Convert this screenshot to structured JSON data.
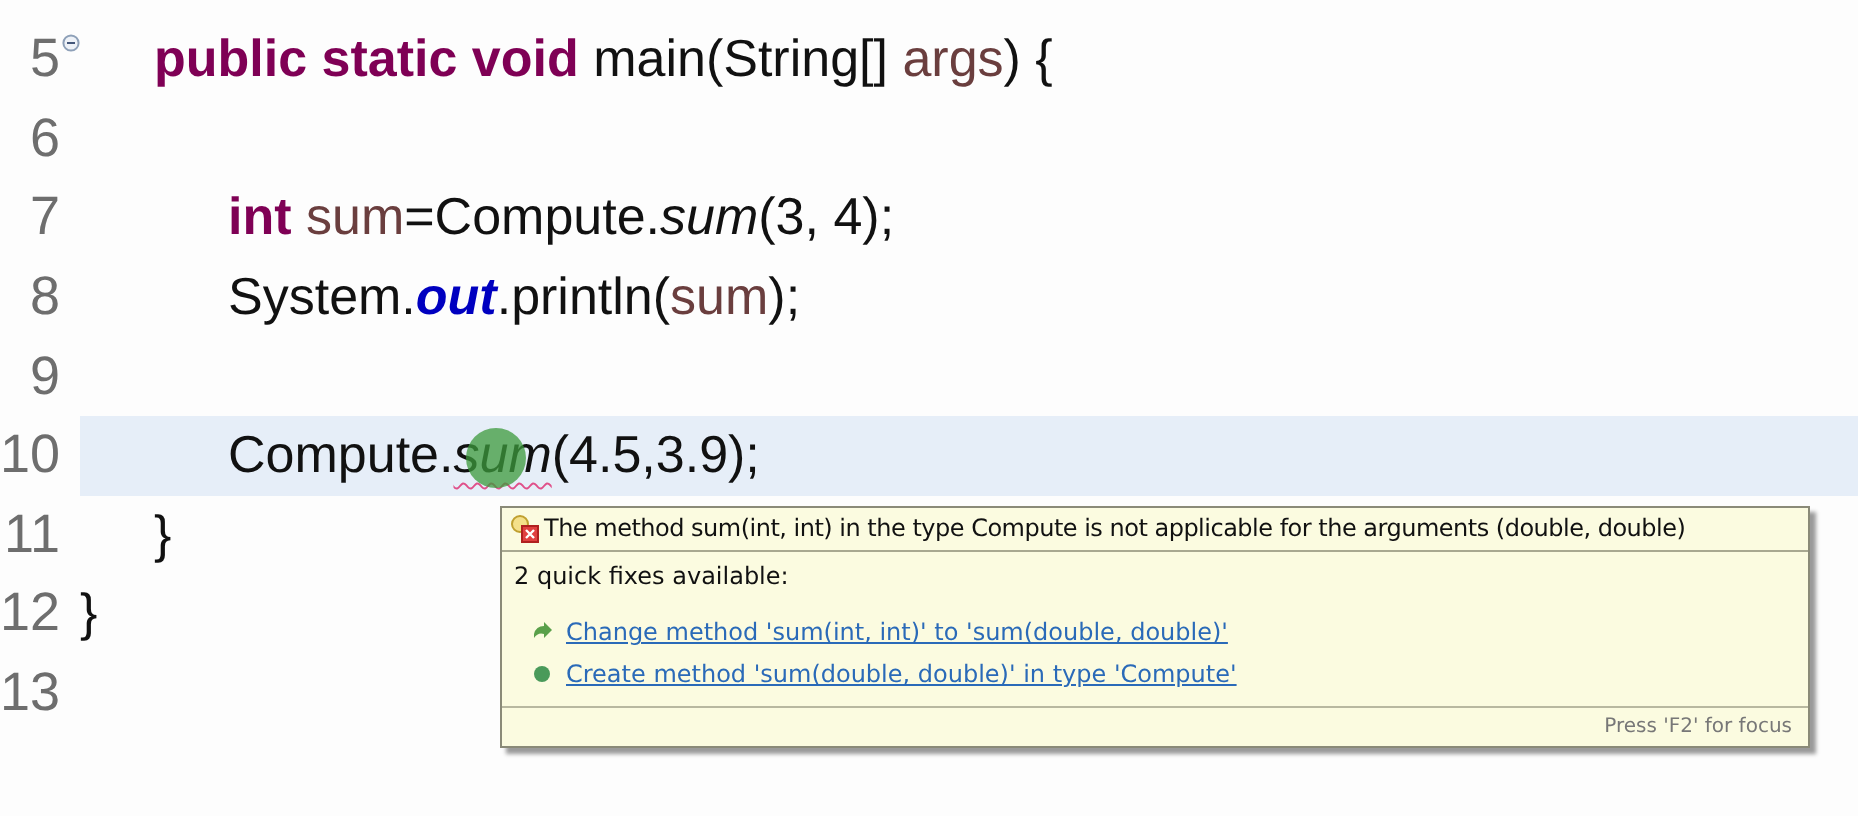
{
  "editor": {
    "lines": [
      {
        "number": "5",
        "fold": true,
        "current": false,
        "tokens": [
          {
            "kind": "keyword",
            "text": "\tpublic static void"
          },
          {
            "kind": "plain",
            "text": " main(String[] "
          },
          {
            "kind": "variable",
            "text": "args"
          },
          {
            "kind": "plain",
            "text": ") {"
          }
        ]
      },
      {
        "number": "6",
        "fold": false,
        "current": false
      },
      {
        "number": "7",
        "fold": false,
        "current": false,
        "tokens": [
          {
            "kind": "keyword",
            "text": "\t\tint"
          },
          {
            "kind": "variable",
            "text": " sum"
          },
          {
            "kind": "plain",
            "text": "=Compute."
          },
          {
            "kind": "static_method",
            "text": "sum"
          },
          {
            "kind": "plain",
            "text": "(3, 4);"
          }
        ]
      },
      {
        "number": "8",
        "fold": false,
        "current": false,
        "tokens": [
          {
            "kind": "plain",
            "text": "\t\tSystem."
          },
          {
            "kind": "static_field",
            "text": "out"
          },
          {
            "kind": "plain",
            "text": ".println("
          },
          {
            "kind": "variable",
            "text": "sum"
          },
          {
            "kind": "plain",
            "text": ");"
          }
        ]
      },
      {
        "number": "9",
        "fold": false,
        "current": false
      },
      {
        "number": "10",
        "fold": false,
        "current": true,
        "tokens": [
          {
            "kind": "plain",
            "text": "\t\tCompute."
          },
          {
            "kind": "error_method",
            "text": "sum",
            "click_marker": true
          },
          {
            "kind": "plain",
            "text": "(4.5,3.9);"
          }
        ]
      },
      {
        "number": "11",
        "fold": false,
        "current": false,
        "tokens": [
          {
            "kind": "plain",
            "text": "\t}"
          }
        ]
      },
      {
        "number": "12",
        "fold": false,
        "current": false,
        "tokens": [
          {
            "kind": "plain",
            "text": "}"
          }
        ]
      },
      {
        "number": "13",
        "fold": false,
        "current": false
      }
    ]
  },
  "quick_fix_popup": {
    "message": "The method sum(int, int) in the type Compute is not applicable for the arguments (double, double)",
    "title": "2 quick fixes available:",
    "fixes": [
      {
        "kind": "change",
        "text": "Change method 'sum(int, int)' to 'sum(double, double)'"
      },
      {
        "kind": "create",
        "text": "Create method 'sum(double, double)' in type 'Compute'"
      }
    ],
    "footer": "Press 'F2' for focus"
  }
}
